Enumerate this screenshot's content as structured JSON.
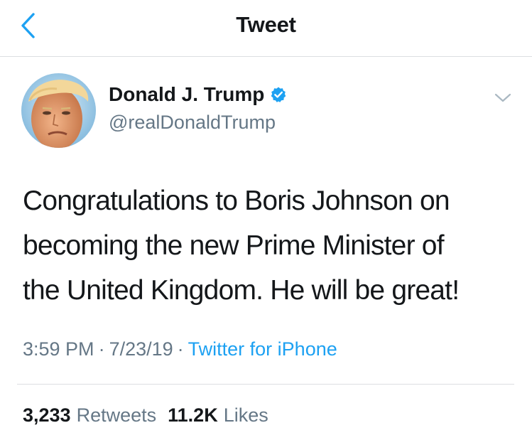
{
  "header": {
    "title": "Tweet",
    "back_icon": "chevron-left-icon"
  },
  "author": {
    "display_name": "Donald J. Trump",
    "handle": "@realDonaldTrump",
    "verified_icon": "verified-badge-icon"
  },
  "tweet": {
    "lines": [
      "Congratulations to Boris Johnson on",
      "becoming the new Prime Minister of",
      "the United Kingdom. He will be great!"
    ]
  },
  "meta": {
    "time": "3:59 PM",
    "separator": "·",
    "date": "7/23/19",
    "source": "Twitter for iPhone"
  },
  "stats": {
    "retweets_count": "3,233",
    "retweets_label": "Retweets",
    "likes_count": "11.2K",
    "likes_label": "Likes"
  },
  "colors": {
    "accent": "#1da1f2",
    "text": "#14171a",
    "muted": "#657786",
    "divider": "#dcdfe2"
  }
}
